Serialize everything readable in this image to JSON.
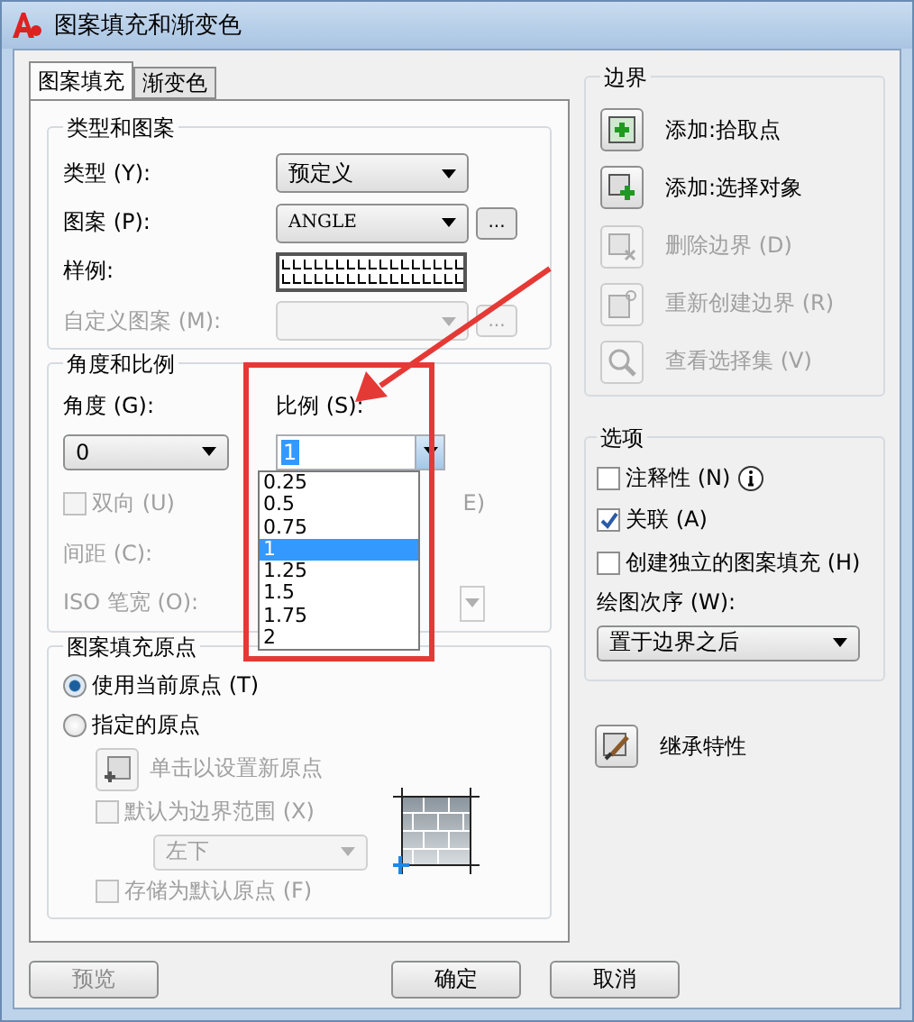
{
  "window": {
    "title": "图案填充和渐变色"
  },
  "tabs": [
    {
      "label": "图案填充",
      "selected": true
    },
    {
      "label": "渐变色",
      "selected": false
    }
  ],
  "type_and_pattern": {
    "title": "类型和图案",
    "fields": [
      {
        "label": "类型 (Y):",
        "kind": "dropdown",
        "value": "预定义",
        "disabled": false
      },
      {
        "label": "图案 (P):",
        "kind": "dropdown_browse",
        "value": "ANGLE",
        "browse": "...",
        "disabled": false
      },
      {
        "label": "样例:",
        "kind": "swatch",
        "disabled": false
      },
      {
        "label": "自定义图案 (M):",
        "kind": "dropdown_browse",
        "browse": "...",
        "disabled": true
      }
    ]
  },
  "angle_and_scale": {
    "title": "角度和比例",
    "angle": {
      "label": "角度 (G):",
      "value": "0"
    },
    "scale": {
      "label": "比例 (S):",
      "value": "1",
      "expanded": true,
      "options": [
        {
          "label": "0.25",
          "selected": false
        },
        {
          "label": "0.5",
          "selected": false
        },
        {
          "label": "0.75",
          "selected": false
        },
        {
          "label": "1",
          "selected": true
        },
        {
          "label": "1.25",
          "selected": false
        },
        {
          "label": "1.5",
          "selected": false
        },
        {
          "label": "1.75",
          "selected": false
        },
        {
          "label": "2",
          "selected": false
        }
      ]
    },
    "double": {
      "label": "双向 (U)",
      "checked": false,
      "disabled": true
    },
    "relative_fragment": "E)",
    "spacing": {
      "label": "间距 (C):",
      "disabled": true
    },
    "iso_pen": {
      "label": "ISO 笔宽 (O):",
      "disabled": true
    }
  },
  "origin": {
    "title": "图案填充原点",
    "radios": [
      {
        "label": "使用当前原点 (T)",
        "selected": true
      },
      {
        "label": "指定的原点",
        "selected": false
      }
    ],
    "set_origin": {
      "label": "单击以设置新原点",
      "disabled": true
    },
    "default_extent": {
      "label": "默认为边界范围 (X)",
      "checked": false,
      "disabled": true
    },
    "position": {
      "value": "左下",
      "disabled": true
    },
    "store_default": {
      "label": "存储为默认原点 (F)",
      "checked": false,
      "disabled": true
    }
  },
  "boundaries": {
    "title": "边界",
    "actions": [
      {
        "label": "添加:拾取点",
        "kind": "pick",
        "disabled": false
      },
      {
        "label": "添加:选择对象",
        "kind": "select",
        "disabled": false
      },
      {
        "label": "删除边界 (D)",
        "kind": "remove",
        "disabled": true
      },
      {
        "label": "重新创建边界 (R)",
        "kind": "recreate",
        "disabled": true
      },
      {
        "label": "查看选择集 (V)",
        "kind": "view",
        "disabled": true
      }
    ]
  },
  "options": {
    "title": "选项",
    "checks": [
      {
        "label": "注释性 (N)",
        "checked": false,
        "info": true
      },
      {
        "label": "关联 (A)",
        "checked": true,
        "info": false
      },
      {
        "label": "创建独立的图案填充 (H)",
        "checked": false,
        "info": false
      }
    ],
    "draw_order": {
      "label": "绘图次序 (W):",
      "value": "置于边界之后"
    }
  },
  "inherit": {
    "label": "继承特性"
  },
  "buttons": [
    {
      "label": "预览",
      "disabled": true
    },
    {
      "label": "确定",
      "disabled": false
    },
    {
      "label": "取消",
      "disabled": false
    }
  ],
  "highlight_frame": {
    "color": "#e53935"
  },
  "pointer_arrow": {
    "color": "#e53935"
  }
}
